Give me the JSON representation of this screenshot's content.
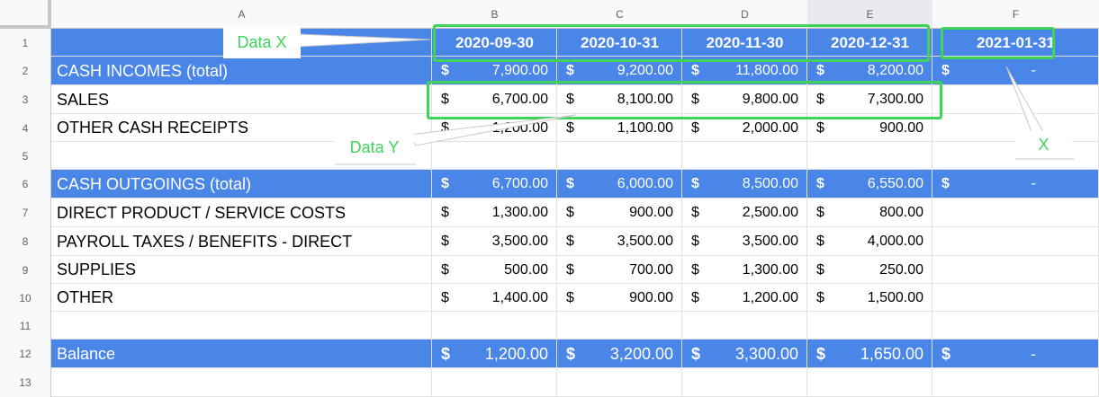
{
  "columns": [
    "A",
    "B",
    "C",
    "D",
    "E",
    "F"
  ],
  "rows": [
    "1",
    "2",
    "3",
    "4",
    "5",
    "6",
    "7",
    "8",
    "9",
    "10",
    "11",
    "12",
    "13"
  ],
  "dates": [
    "2020-09-30",
    "2020-10-31",
    "2020-11-30",
    "2020-12-31",
    "2021-01-31"
  ],
  "labels": {
    "cash_incomes": "CASH INCOMES (total)",
    "sales": "SALES",
    "other_receipts": "OTHER CASH RECEIPTS",
    "cash_outgoings": "CASH OUTGOINGS (total)",
    "direct_costs": "DIRECT PRODUCT / SERVICE COSTS",
    "payroll": "PAYROLL TAXES / BENEFITS - DIRECT",
    "supplies": "SUPPLIES",
    "other": "OTHER",
    "balance": "Balance"
  },
  "currency_symbol": "$",
  "dash": "-",
  "values": {
    "cash_incomes": [
      "7,900.00",
      "9,200.00",
      "11,800.00",
      "8,200.00"
    ],
    "sales": [
      "6,700.00",
      "8,100.00",
      "9,800.00",
      "7,300.00"
    ],
    "other_receipts": [
      "1,200.00",
      "1,100.00",
      "2,000.00",
      "900.00"
    ],
    "cash_outgoings": [
      "6,700.00",
      "6,000.00",
      "8,500.00",
      "6,550.00"
    ],
    "direct_costs": [
      "1,300.00",
      "900.00",
      "2,500.00",
      "800.00"
    ],
    "payroll": [
      "3,500.00",
      "3,500.00",
      "3,500.00",
      "4,000.00"
    ],
    "supplies": [
      "500.00",
      "700.00",
      "1,300.00",
      "250.00"
    ],
    "other": [
      "1,400.00",
      "900.00",
      "1,200.00",
      "1,500.00"
    ],
    "balance": [
      "1,200.00",
      "3,200.00",
      "3,300.00",
      "1,650.00"
    ]
  },
  "annotations": {
    "data_x": "Data X",
    "data_y": "Data Y",
    "x": "X"
  },
  "colors": {
    "header_blue": "#4a86e8",
    "highlight_green": "#3fd35a"
  }
}
